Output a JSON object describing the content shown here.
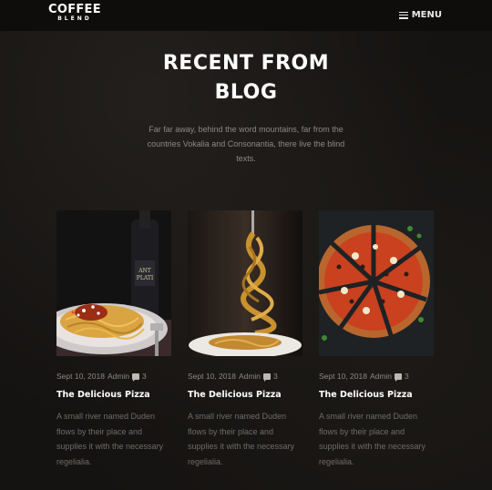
{
  "nav": {
    "brand_main": "COFFEE",
    "brand_sub": "BLEND",
    "menu_label": "MENU"
  },
  "section": {
    "title_line1": "RECENT FROM",
    "title_line2": "BLOG",
    "lead": "Far far away, behind the word mountains, far from the countries Vokalia and Consonantia, there live the blind texts."
  },
  "posts": [
    {
      "date": "Sept 10, 2018",
      "author": "Admin",
      "comments": "3",
      "title": "The Delicious Pizza",
      "excerpt": "A small river named Duden flows by their place and supplies it with the necessary regelialia.",
      "image": "spaghetti-plate-image"
    },
    {
      "date": "Sept 10, 2018",
      "author": "Admin",
      "comments": "3",
      "title": "The Delicious Pizza",
      "excerpt": "A small river named Duden flows by their place and supplies it with the necessary regelialia.",
      "image": "pasta-fork-image"
    },
    {
      "date": "Sept 10, 2018",
      "author": "Admin",
      "comments": "3",
      "title": "The Delicious Pizza",
      "excerpt": "A small river named Duden flows by their place and supplies it with the necessary regelialia.",
      "image": "pizza-image"
    }
  ]
}
